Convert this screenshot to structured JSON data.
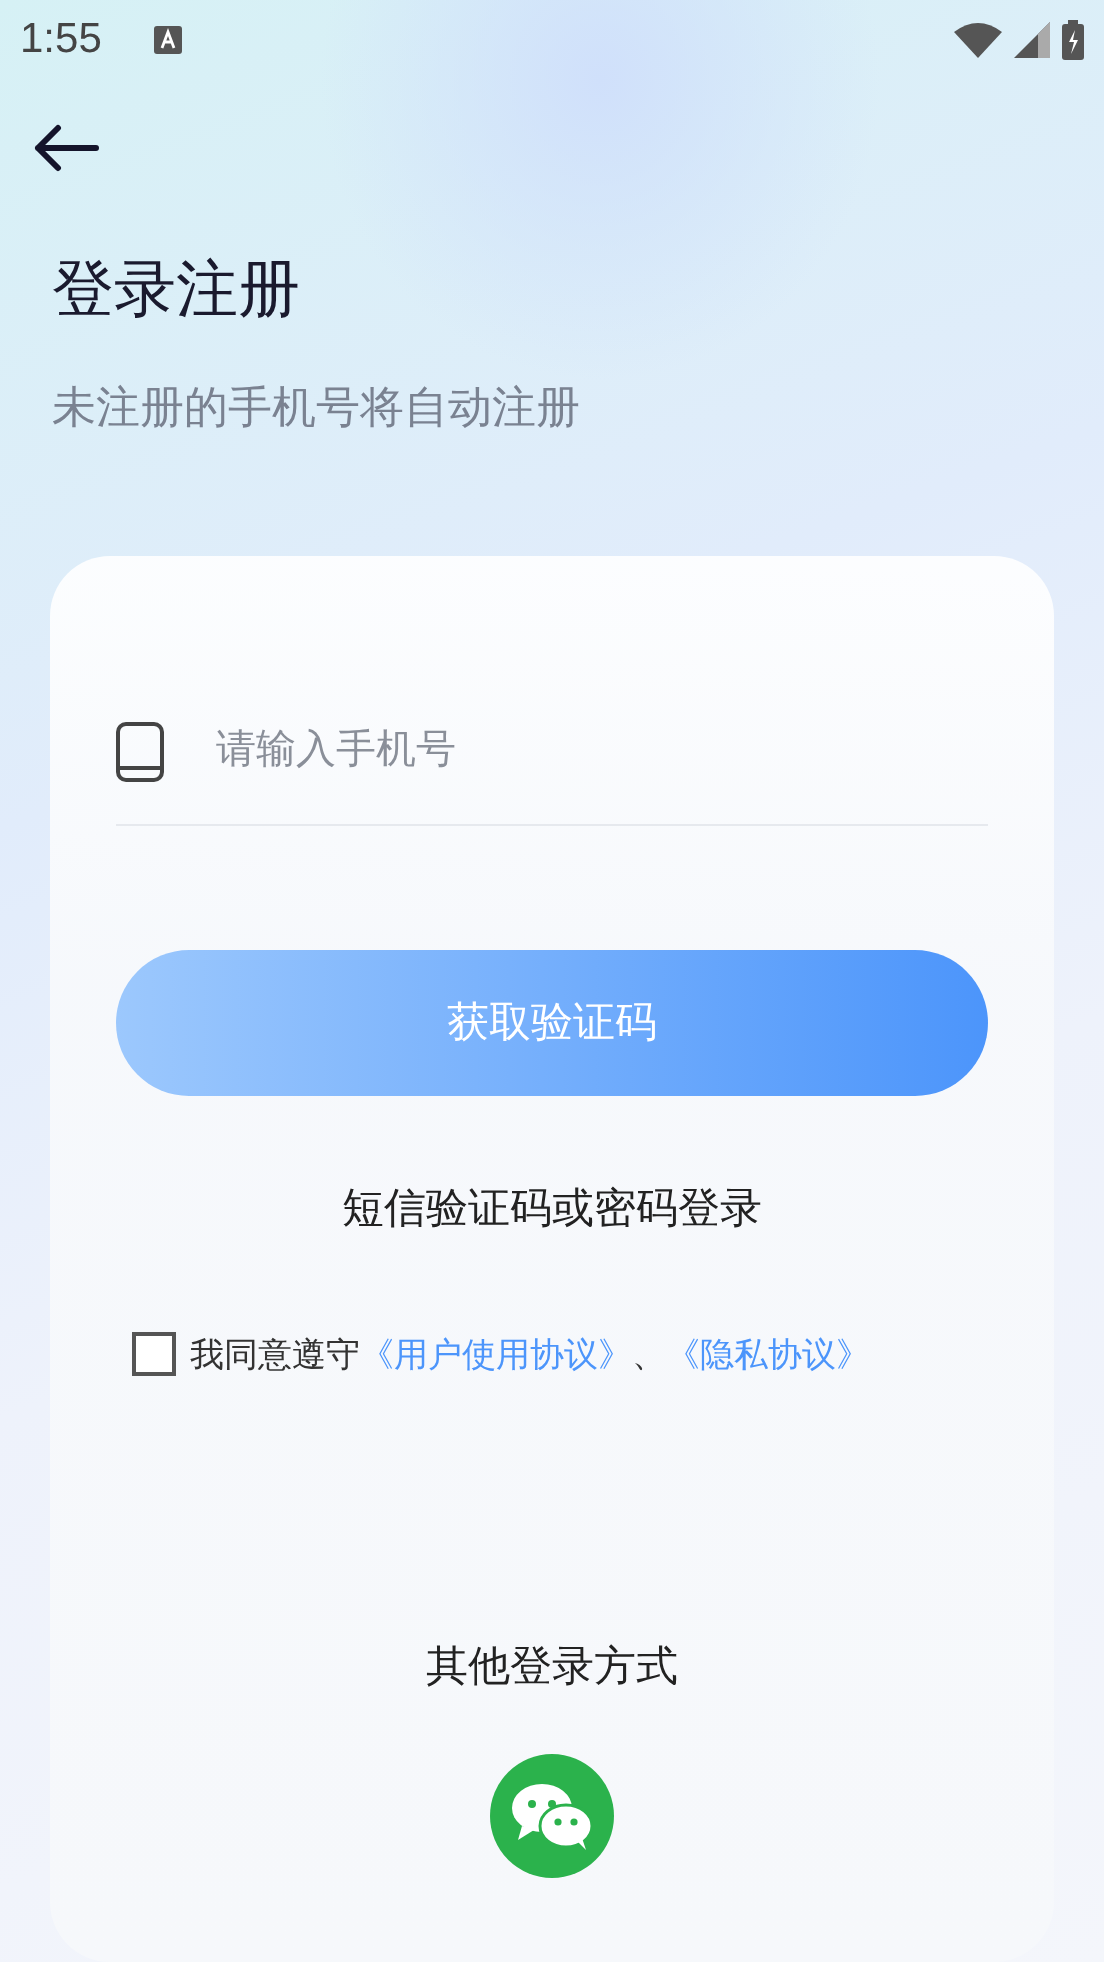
{
  "status_bar": {
    "time": "1:55"
  },
  "title": "登录注册",
  "subtitle": "未注册的手机号将自动注册",
  "phone_field": {
    "placeholder": "请输入手机号"
  },
  "get_code_button": "获取验证码",
  "alt_login_link": "短信验证码或密码登录",
  "agreement": {
    "checked": false,
    "text": "我同意遵守",
    "links": [
      "《用户使用协议》",
      "《隐私协议》"
    ],
    "separator": "、"
  },
  "other_login": {
    "label": "其他登录方式"
  }
}
